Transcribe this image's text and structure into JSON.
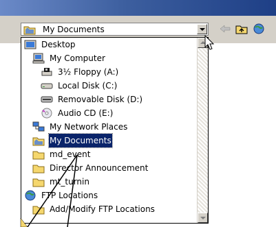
{
  "combo": {
    "value": "My Documents",
    "icon": "folder-icon"
  },
  "toolbar": {
    "buttons": [
      "back-arrow-icon",
      "up-folder-icon",
      "web-icon"
    ]
  },
  "dropdown": {
    "items": [
      {
        "label": "Desktop",
        "icon": "desktop-icon"
      },
      {
        "label": "My Computer",
        "icon": "computer-icon"
      },
      {
        "label": "3½ Floppy (A:)",
        "icon": "floppy-icon"
      },
      {
        "label": "Local Disk (C:)",
        "icon": "disk-icon"
      },
      {
        "label": "Removable Disk (D:)",
        "icon": "removable-disk-icon"
      },
      {
        "label": "Audio CD (E:)",
        "icon": "cd-icon"
      },
      {
        "label": "My Network Places",
        "icon": "network-icon"
      },
      {
        "label": "My Documents",
        "icon": "documents-icon",
        "selected": true
      },
      {
        "label": "md_event",
        "icon": "folder-icon"
      },
      {
        "label": "Director Announcement",
        "icon": "folder-icon"
      },
      {
        "label": "mt_turnin",
        "icon": "folder-icon"
      },
      {
        "label": "FTP Locations",
        "icon": "ftp-icon"
      },
      {
        "label": "Add/Modify FTP Locations",
        "icon": "ftp-add-icon"
      }
    ]
  },
  "colors": {
    "highlight": "#0a246a",
    "folder": "#f5d76e",
    "titlebar": "#1e3f86"
  }
}
